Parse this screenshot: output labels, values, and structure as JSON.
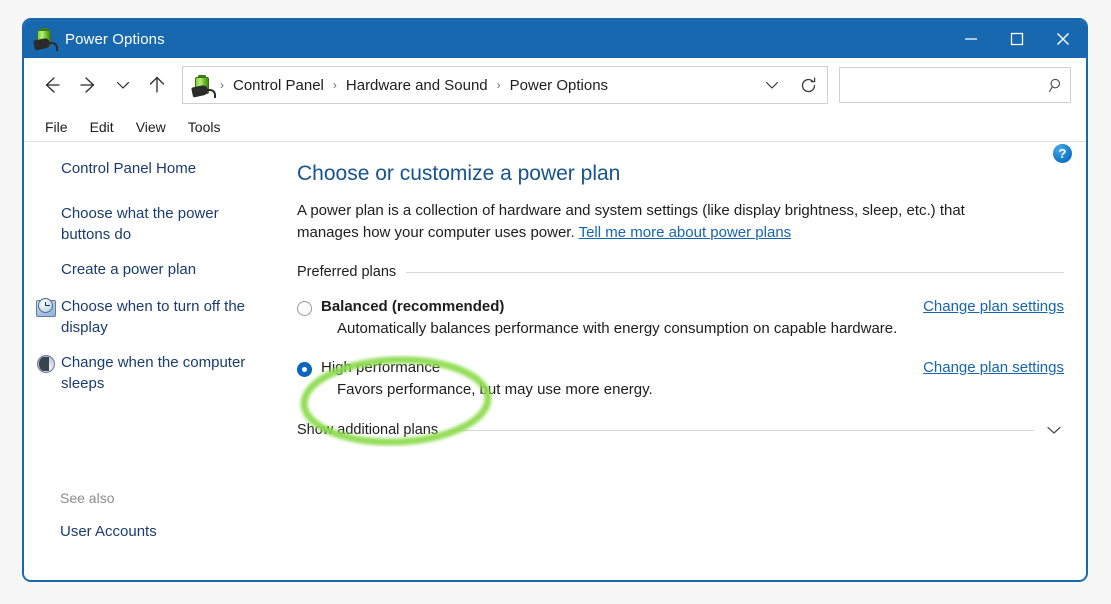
{
  "window": {
    "title": "Power Options",
    "icon": "battery-plug-icon",
    "accent_color": "#1768af",
    "controls": {
      "minimize": "minimize-icon",
      "maximize": "maximize-icon",
      "close": "close-icon"
    }
  },
  "navbar": {
    "back": "back-arrow-icon",
    "forward": "forward-arrow-icon",
    "recent": "chevron-down-icon",
    "up": "up-arrow-icon",
    "crumb_icon": "battery-plug-icon",
    "breadcrumbs": [
      "Control Panel",
      "Hardware and Sound",
      "Power Options"
    ],
    "separator": "›",
    "dropdown": "chevron-down-icon",
    "refresh": "refresh-icon"
  },
  "search": {
    "value": "",
    "placeholder": "",
    "icon": "search-icon"
  },
  "menubar": {
    "items": [
      "File",
      "Edit",
      "View",
      "Tools"
    ]
  },
  "sidebar": {
    "items": [
      {
        "label": "Control Panel Home",
        "icon": ""
      },
      {
        "label": "Choose what the power buttons do",
        "icon": ""
      },
      {
        "label": "Create a power plan",
        "icon": ""
      },
      {
        "label": "Choose when to turn off the display",
        "icon": "clock-icon"
      },
      {
        "label": "Change when the computer sleeps",
        "icon": "moon-icon"
      }
    ],
    "see_also_label": "See also",
    "see_also_link": "User Accounts"
  },
  "main": {
    "help_button": "?",
    "title": "Choose or customize a power plan",
    "description": "A power plan is a collection of hardware and system settings (like display brightness, sleep, etc.) that manages how your computer uses power.",
    "description_link": "Tell me more about power plans",
    "preferred_plans_label": "Preferred plans",
    "plans": [
      {
        "name": "Balanced (recommended)",
        "description": "Automatically balances performance with energy consumption on capable hardware.",
        "selected": false,
        "bold": true,
        "link": "Change plan settings"
      },
      {
        "name": "High performance",
        "description": "Favors performance, but may use more energy.",
        "selected": true,
        "bold": false,
        "link": "Change plan settings"
      }
    ],
    "show_additional_label": "Show additional plans",
    "show_additional_chevron": "chevron-down-icon"
  },
  "annotation": {
    "type": "ellipse-highlight",
    "color": "#8ddb4d",
    "target": "High performance plan"
  }
}
